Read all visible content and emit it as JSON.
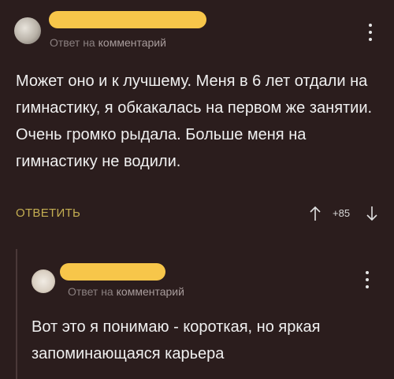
{
  "comments": [
    {
      "reply_meta_prefix": "Ответ на",
      "reply_meta_target": "комментарий",
      "text": "Может оно и к лучшему. Меня в 6 лет отдали на гимнастику, я обкакалась на первом же занятии. Очень громко рыдала. Больше меня на гимнастику не водили.",
      "reply_label": "ОТВЕТИТЬ",
      "votes": "+85"
    },
    {
      "reply_meta_prefix": "Ответ на",
      "reply_meta_target": "комментарий",
      "text": "Вот это я понимаю - короткая, но яркая запоминающаяся карьера"
    }
  ],
  "icons": {
    "menu": "kebab-menu-icon",
    "upvote": "arrow-up-icon",
    "downvote": "arrow-down-icon"
  },
  "colors": {
    "background": "#2b1d1d",
    "username_redaction": "#f7c64a",
    "reply_accent": "#c4ae52",
    "meta_text": "#8b8080"
  }
}
